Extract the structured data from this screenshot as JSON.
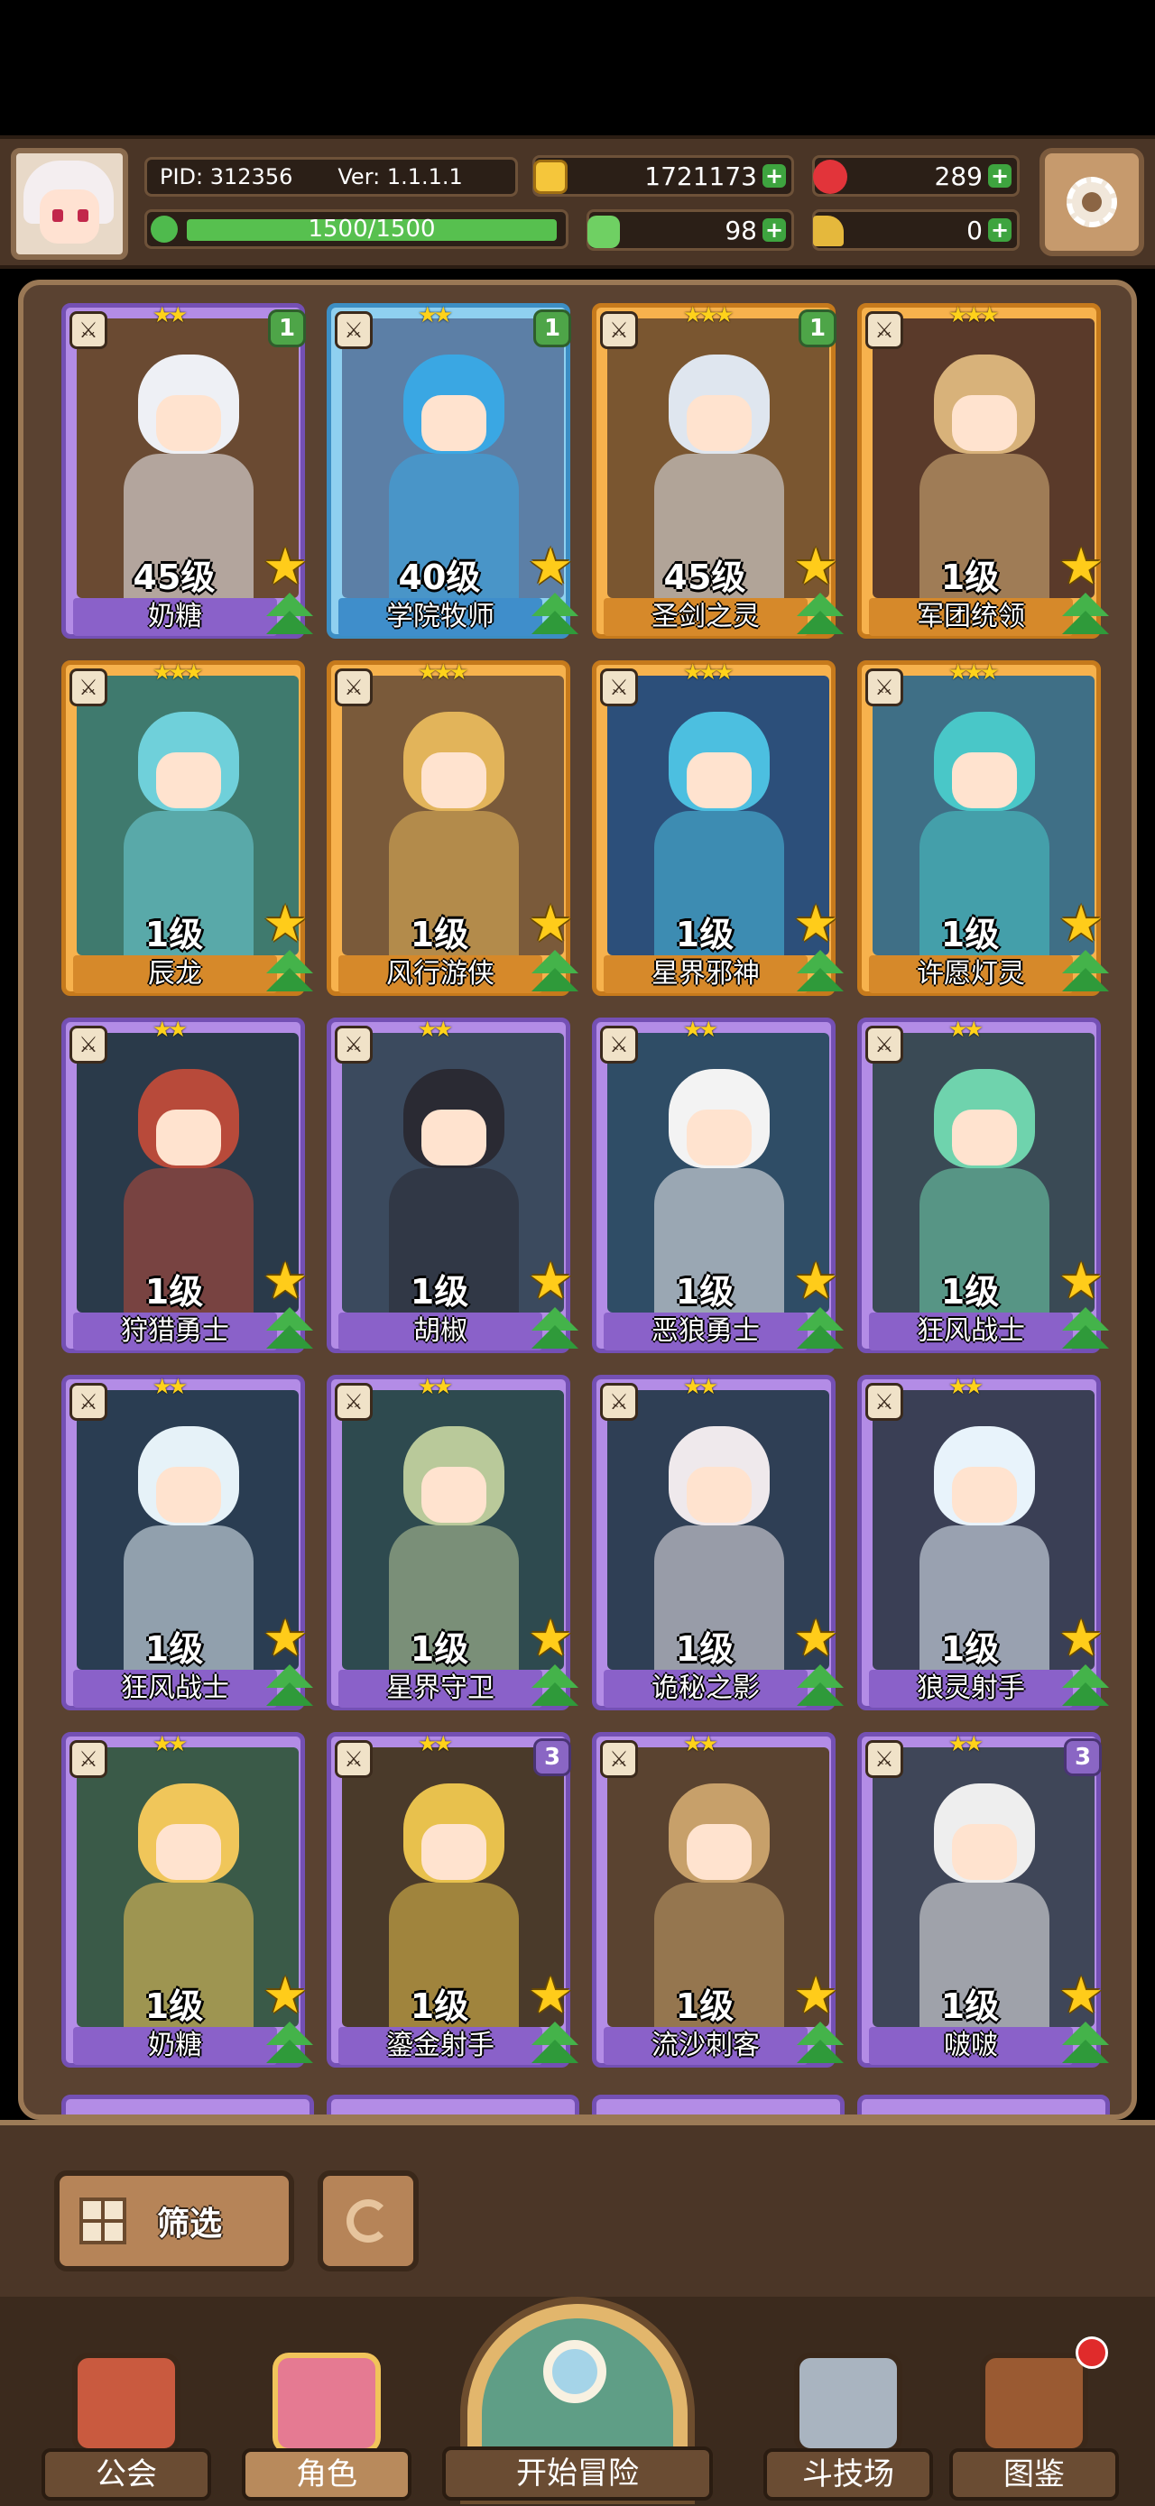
{
  "header": {
    "pid_label": "PID: 312356",
    "version_label": "Ver: 1.1.1.1",
    "energy": "1500/1500",
    "energy_fraction": 1.0,
    "gold": "1721173",
    "gems": "289",
    "clover": "98",
    "keys": "0",
    "plus": "+"
  },
  "heroes": [
    {
      "name": "奶糖",
      "level": "45级",
      "stars": "★★",
      "rarity": "purple",
      "badge": "1",
      "class_icon": "sword-icon"
    },
    {
      "name": "学院牧师",
      "level": "40级",
      "stars": "★★",
      "rarity": "blue",
      "badge": "1",
      "class_icon": "cross-icon"
    },
    {
      "name": "圣剑之灵",
      "level": "45级",
      "stars": "★★★",
      "rarity": "gold",
      "badge": "1",
      "class_icon": "sword-icon"
    },
    {
      "name": "军团统领",
      "level": "1级",
      "stars": "★★★",
      "rarity": "gold",
      "badge": "",
      "class_icon": "boot-icon"
    },
    {
      "name": "辰龙",
      "level": "1级",
      "stars": "★★★",
      "rarity": "gold",
      "badge": "",
      "class_icon": "boot-icon"
    },
    {
      "name": "风行游侠",
      "level": "1级",
      "stars": "★★★",
      "rarity": "gold",
      "badge": "",
      "class_icon": "bow-icon"
    },
    {
      "name": "星界邪神",
      "level": "1级",
      "stars": "★★★",
      "rarity": "gold",
      "badge": "",
      "class_icon": "staff-icon"
    },
    {
      "name": "许愿灯灵",
      "level": "1级",
      "stars": "★★★",
      "rarity": "gold",
      "badge": "",
      "class_icon": "cross-icon"
    },
    {
      "name": "狩猎勇士",
      "level": "1级",
      "stars": "★★",
      "rarity": "purple",
      "badge": "",
      "class_icon": "boot-icon"
    },
    {
      "name": "胡椒",
      "level": "1级",
      "stars": "★★",
      "rarity": "purple",
      "badge": "",
      "class_icon": "boot-icon"
    },
    {
      "name": "恶狼勇士",
      "level": "1级",
      "stars": "★★",
      "rarity": "purple",
      "badge": "",
      "class_icon": "boot-icon"
    },
    {
      "name": "狂风战士",
      "level": "1级",
      "stars": "★★",
      "rarity": "purple",
      "badge": "",
      "class_icon": "boot-icon"
    },
    {
      "name": "狂风战士",
      "level": "1级",
      "stars": "★★",
      "rarity": "purple",
      "badge": "",
      "class_icon": "boot-icon"
    },
    {
      "name": "星界守卫",
      "level": "1级",
      "stars": "★★",
      "rarity": "purple",
      "badge": "",
      "class_icon": "boot-icon"
    },
    {
      "name": "诡秘之影",
      "level": "1级",
      "stars": "★★",
      "rarity": "purple",
      "badge": "",
      "class_icon": "bow-icon"
    },
    {
      "name": "狼灵射手",
      "level": "1级",
      "stars": "★★",
      "rarity": "purple",
      "badge": "",
      "class_icon": "bow-icon"
    },
    {
      "name": "奶糖",
      "level": "1级",
      "stars": "★★",
      "rarity": "purple",
      "badge": "",
      "class_icon": "sword-icon"
    },
    {
      "name": "鎏金射手",
      "level": "1级",
      "stars": "★★",
      "rarity": "purple",
      "badge": "3",
      "class_icon": "boot-icon"
    },
    {
      "name": "流沙刺客",
      "level": "1级",
      "stars": "★★",
      "rarity": "purple",
      "badge": "",
      "class_icon": "boot-icon"
    },
    {
      "name": "啵啵",
      "level": "1级",
      "stars": "★★",
      "rarity": "purple",
      "badge": "3",
      "class_icon": "staff-icon"
    }
  ],
  "controls": {
    "filter_label": "筛选"
  },
  "nav": {
    "guild": "公会",
    "roles": "角色",
    "adventure": "开始冒险",
    "arena": "斗技场",
    "codex": "图鉴"
  },
  "colors": {
    "purple": "#8a61c9",
    "gold": "#d6892a",
    "blue": "#3f8ecb",
    "panel_bg": "#5a4231"
  }
}
